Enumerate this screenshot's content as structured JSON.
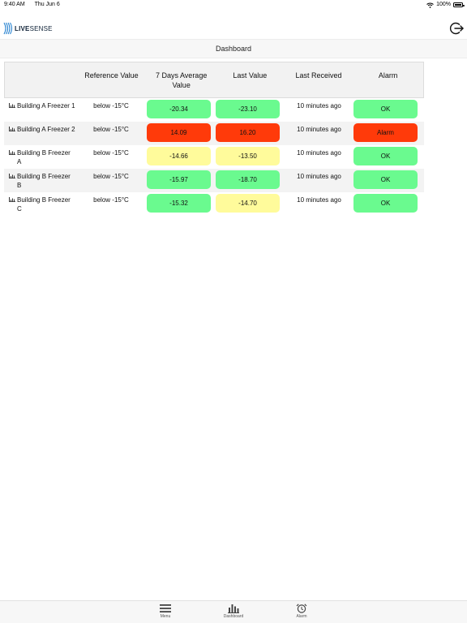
{
  "status_bar": {
    "time": "9:40 AM",
    "date": "Thu Jun 6",
    "battery": "100%"
  },
  "header": {
    "logo_bold": "LIVE",
    "logo_light": "SENSE"
  },
  "title": "Dashboard",
  "table": {
    "columns": [
      "",
      "Reference Value",
      "7 Days Average Value",
      "Last Value",
      "Last Received",
      "Alarm"
    ],
    "rows": [
      {
        "name": "Building A Freezer 1",
        "reference": "below -15°C",
        "avg": "-20.34",
        "avg_status": "green",
        "last": "-23.10",
        "last_status": "green",
        "received": "10 minutes ago",
        "alarm": "OK",
        "alarm_status": "green"
      },
      {
        "name": "Building A Freezer 2",
        "reference": "below -15°C",
        "avg": "14.09",
        "avg_status": "red",
        "last": "16.20",
        "last_status": "red",
        "received": "10 minutes ago",
        "alarm": "Alarm",
        "alarm_status": "red"
      },
      {
        "name": "Building B Freezer A",
        "reference": "below -15°C",
        "avg": "-14.66",
        "avg_status": "yellow",
        "last": "-13.50",
        "last_status": "yellow",
        "received": "10 minutes ago",
        "alarm": "OK",
        "alarm_status": "green"
      },
      {
        "name": "Building B Freezer B",
        "reference": "below -15°C",
        "avg": "-15.97",
        "avg_status": "green",
        "last": "-18.70",
        "last_status": "green",
        "received": "10 minutes ago",
        "alarm": "OK",
        "alarm_status": "green"
      },
      {
        "name": "Building B Freezer C",
        "reference": "below -15°C",
        "avg": "-15.32",
        "avg_status": "green",
        "last": "-14.70",
        "last_status": "yellow",
        "received": "10 minutes ago",
        "alarm": "OK",
        "alarm_status": "green"
      }
    ]
  },
  "tabs": [
    {
      "label": "Menu",
      "icon": "menu-icon"
    },
    {
      "label": "Dashboard",
      "icon": "bar-chart-icon"
    },
    {
      "label": "Alarm",
      "icon": "alarm-clock-icon"
    }
  ],
  "colors": {
    "green": "#6afa8f",
    "red": "#ff3a0a",
    "yellow": "#fffb9b",
    "logo": "#0f2237"
  }
}
